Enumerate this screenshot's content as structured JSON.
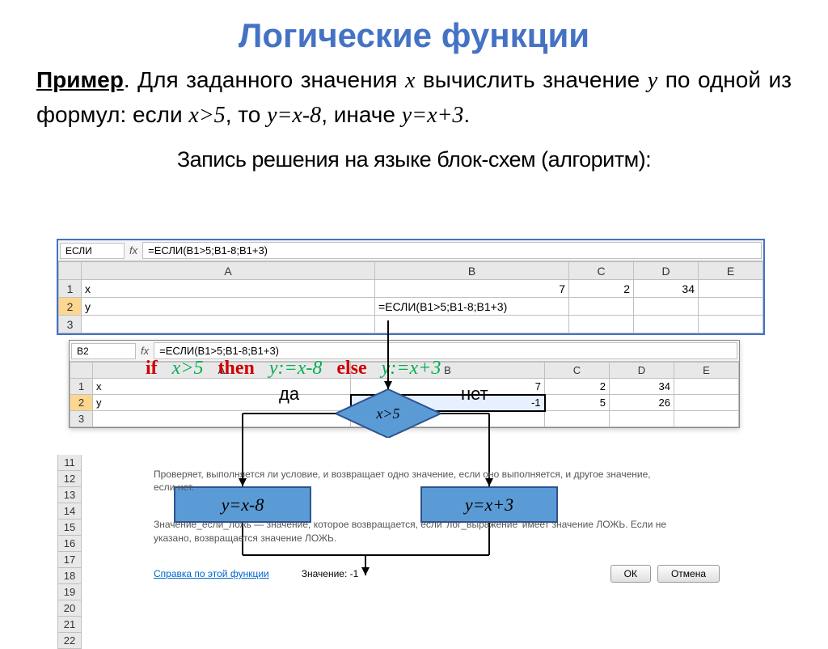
{
  "title": "Логические функции",
  "example": {
    "label": "Пример",
    "text_part1": ". Для заданного значения ",
    "var_x": "x",
    "text_part2": " вычислить значение ",
    "var_y": "y",
    "text_part3": " по одной из формул: если ",
    "cond": "x>5",
    "text_part4": ", то ",
    "then_expr": "y=x-8",
    "text_part5": ", иначе ",
    "else_expr": "y=x+3",
    "text_part6": "."
  },
  "subtitle": "Запись решения на языке блок-схем (алгоритм):",
  "sheet1": {
    "namebox": "ЕСЛИ",
    "formula": "=ЕСЛИ(B1>5;B1-8;B1+3)",
    "cols": [
      "",
      "A",
      "B",
      "C",
      "D",
      "E"
    ],
    "rows": [
      {
        "n": "1",
        "A": "x",
        "B": "7",
        "C": "2",
        "D": "34",
        "E": ""
      },
      {
        "n": "2",
        "A": "y",
        "B": "=ЕСЛИ(B1>5;B1-8;B1+3)",
        "C": "",
        "D": "",
        "E": ""
      },
      {
        "n": "3",
        "A": "",
        "B": "",
        "C": "",
        "D": "",
        "E": ""
      }
    ]
  },
  "sheet2": {
    "namebox": "B2",
    "formula": "=ЕСЛИ(B1>5;B1-8;B1+3)",
    "cols": [
      "",
      "A",
      "B",
      "C",
      "D",
      "E"
    ],
    "rows": [
      {
        "n": "1",
        "A": "x",
        "B": "7",
        "C": "2",
        "D": "34",
        "E": ""
      },
      {
        "n": "2",
        "A": "y",
        "B": "-1",
        "C": "5",
        "D": "26",
        "E": ""
      },
      {
        "n": "3",
        "A": "",
        "B": "",
        "C": "",
        "D": "",
        "E": ""
      }
    ]
  },
  "code": {
    "if": "if",
    "cond": "x>5",
    "then": "then",
    "then_expr": "y:=x-8",
    "else": "else",
    "else_expr": "y:=x+3"
  },
  "flow": {
    "cond": "x>5",
    "yes": "да",
    "no": "нет",
    "left": "y=x-8",
    "right": "y=x+3"
  },
  "help": {
    "line1": "Проверяет, выполняется ли условие, и возвращает одно значение, если оно выполняется, и другое значение, если нет.",
    "line2": "Значение_если_ложь — значение, которое возвращается, если 'лог_выражение' имеет значение ЛОЖЬ. Если не указано, возвращается значение ЛОЖЬ."
  },
  "dialog": {
    "link": "Справка по этой функции",
    "value_label": "Значение:",
    "value": "-1",
    "ok": "ОК",
    "cancel": "Отмена"
  },
  "extra_rows": [
    "11",
    "12",
    "13",
    "14",
    "15",
    "16",
    "17",
    "18",
    "19",
    "20",
    "21",
    "22"
  ]
}
